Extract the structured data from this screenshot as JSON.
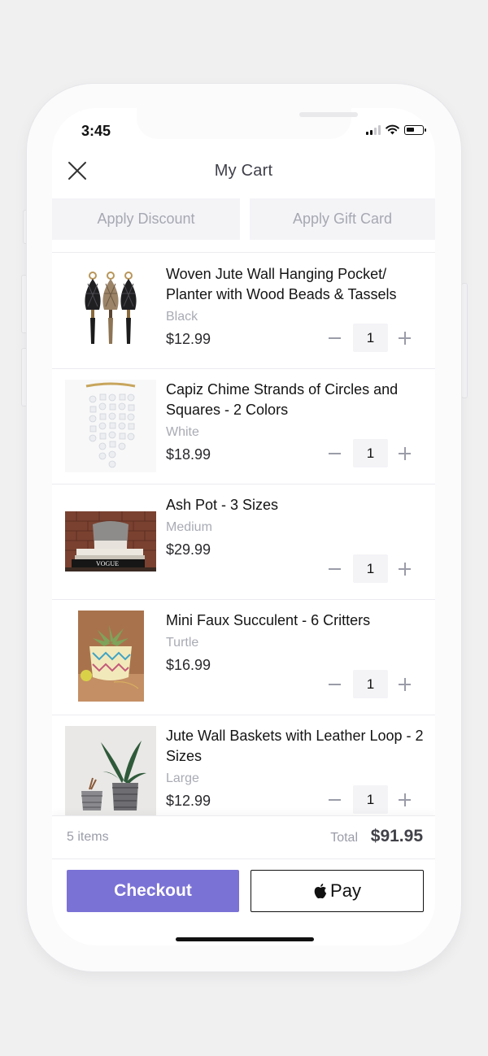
{
  "status_bar": {
    "time": "3:45"
  },
  "header": {
    "title": "My Cart"
  },
  "promo": {
    "discount_label": "Apply Discount",
    "gift_card_label": "Apply Gift Card"
  },
  "items": [
    {
      "name": "Woven Jute Wall Hanging Pocket/ Planter with Wood Beads & Tassels",
      "variant": "Black",
      "price": "$12.99",
      "quantity": "1"
    },
    {
      "name": "Capiz Chime Strands of Circles and Squares - 2 Colors",
      "variant": "White",
      "price": "$18.99",
      "quantity": "1"
    },
    {
      "name": "Ash Pot - 3 Sizes",
      "variant": "Medium",
      "price": "$29.99",
      "quantity": "1",
      "book_text": "VOGUE"
    },
    {
      "name": "Mini Faux Succulent - 6 Critters",
      "variant": "Turtle",
      "price": "$16.99",
      "quantity": "1"
    },
    {
      "name": "Jute Wall Baskets with Leather Loop - 2 Sizes",
      "variant": "Large",
      "price": "$12.99",
      "quantity": "1"
    }
  ],
  "summary": {
    "item_count": "5 items",
    "total_label": "Total",
    "total_value": "$91.95"
  },
  "actions": {
    "checkout_label": "Checkout",
    "apple_pay_label": "Pay"
  },
  "colors": {
    "accent": "#7b72d6",
    "muted_text": "#a9abb4",
    "background": "#f0f0f1"
  }
}
